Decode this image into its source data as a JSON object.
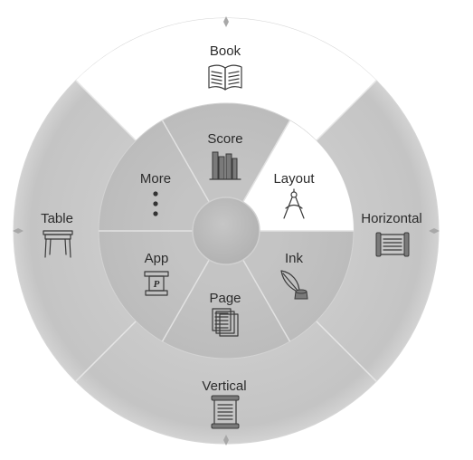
{
  "menu": {
    "outer": {
      "top": {
        "label": "Book",
        "icon": "open-book-icon",
        "selected": true
      },
      "right": {
        "label": "Horizontal",
        "icon": "horizontal-scroll-icon"
      },
      "bottom": {
        "label": "Vertical",
        "icon": "vertical-scroll-icon"
      },
      "left": {
        "label": "Table",
        "icon": "table-icon"
      }
    },
    "inner": [
      {
        "id": "score",
        "label": "Score",
        "icon": "books-on-shelf-icon"
      },
      {
        "id": "layout",
        "label": "Layout",
        "icon": "drafting-compass-icon",
        "selected": true
      },
      {
        "id": "ink",
        "label": "Ink",
        "icon": "quill-and-inkwell-icon"
      },
      {
        "id": "page",
        "label": "Page",
        "icon": "stacked-pages-icon"
      },
      {
        "id": "app",
        "label": "App",
        "icon": "lectern-icon"
      },
      {
        "id": "more",
        "label": "More",
        "icon": "vertical-ellipsis-icon"
      }
    ],
    "center": {
      "icon": "center-hub"
    }
  },
  "colors": {
    "ring_fill": "#c9c9c9",
    "inner_fill": "#c2c2c2",
    "selected_fill": "#ffffff",
    "divider": "#e8e8e8",
    "hub": "#bdbdbd",
    "text": "#2b2b2b"
  }
}
